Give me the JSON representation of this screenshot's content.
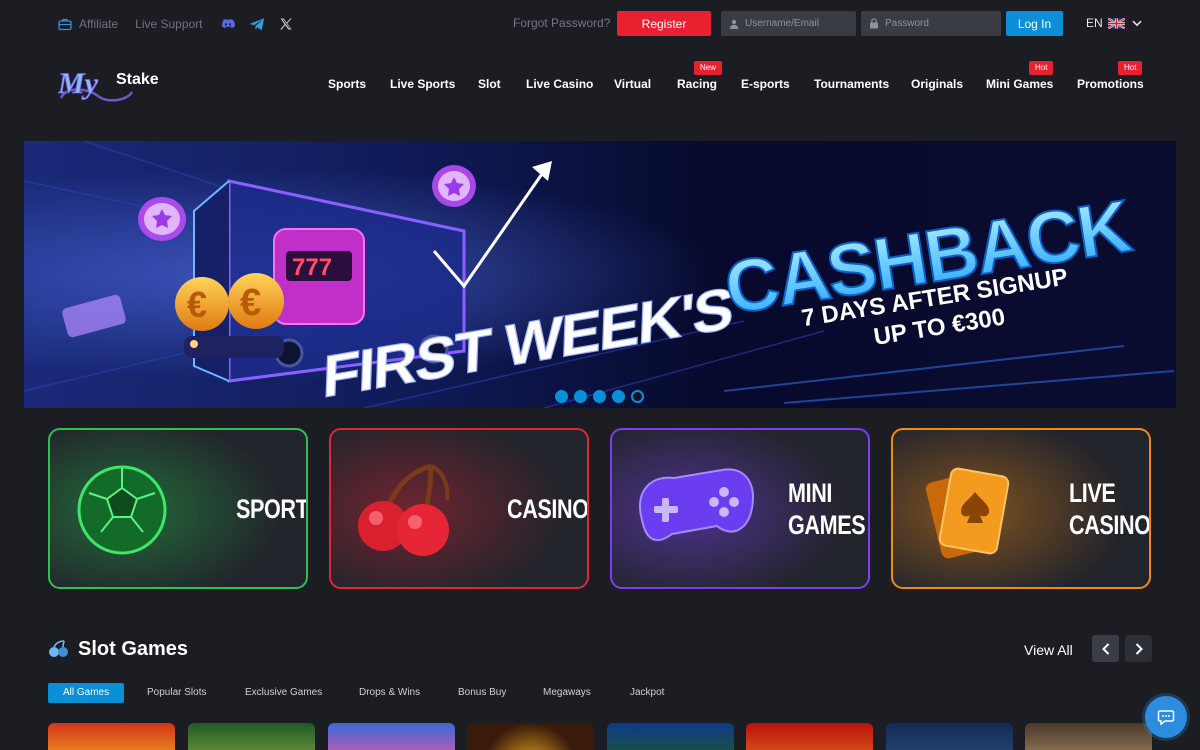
{
  "topbar": {
    "affiliate": "Affiliate",
    "live_support": "Live Support",
    "forgot_password": "Forgot Password?",
    "register": "Register",
    "username_placeholder": "Username/Email",
    "password_placeholder": "Password",
    "login": "Log In",
    "language": "EN"
  },
  "brand": {
    "logo_text": "My",
    "logo_suffix": "Stake"
  },
  "nav": {
    "items": [
      {
        "label": "Sports",
        "badge": ""
      },
      {
        "label": "Live Sports",
        "badge": ""
      },
      {
        "label": "Slot",
        "badge": ""
      },
      {
        "label": "Live Casino",
        "badge": ""
      },
      {
        "label": "Virtual",
        "badge": ""
      },
      {
        "label": "Racing",
        "badge": "New"
      },
      {
        "label": "E-sports",
        "badge": ""
      },
      {
        "label": "Tournaments",
        "badge": ""
      },
      {
        "label": "Originals",
        "badge": ""
      },
      {
        "label": "Mini Games",
        "badge": "Hot"
      },
      {
        "label": "Promotions",
        "badge": "Hot"
      }
    ]
  },
  "hero": {
    "title_left": "FIRST WEEK'S",
    "title_main": "CASHBACK",
    "subtitle_1": "7 DAYS AFTER SIGNUP",
    "subtitle_2": "UP TO €300",
    "slot_text": "777",
    "euro_symbol": "€",
    "slide_count": 5,
    "active_slide": 5
  },
  "categories": [
    {
      "line1": "SPORT",
      "line2": "",
      "color": "#27c24c"
    },
    {
      "line1": "CASINO",
      "line2": "",
      "color": "#e62636"
    },
    {
      "line1": "MINI",
      "line2": "GAMES",
      "color": "#7b3ff2"
    },
    {
      "line1": "LIVE",
      "line2": "CASINO",
      "color": "#f28a12"
    }
  ],
  "slot_games": {
    "title": "Slot Games",
    "view_all": "View All",
    "tabs": [
      "All Games",
      "Popular Slots",
      "Exclusive Games",
      "Drops & Wins",
      "Bonus Buy",
      "Megaways",
      "Jackpot"
    ],
    "active_tab": "All Games"
  },
  "colors": {
    "accent_blue": "#0b8fd6",
    "register_red": "#e9202f",
    "background": "#1c1d22"
  }
}
